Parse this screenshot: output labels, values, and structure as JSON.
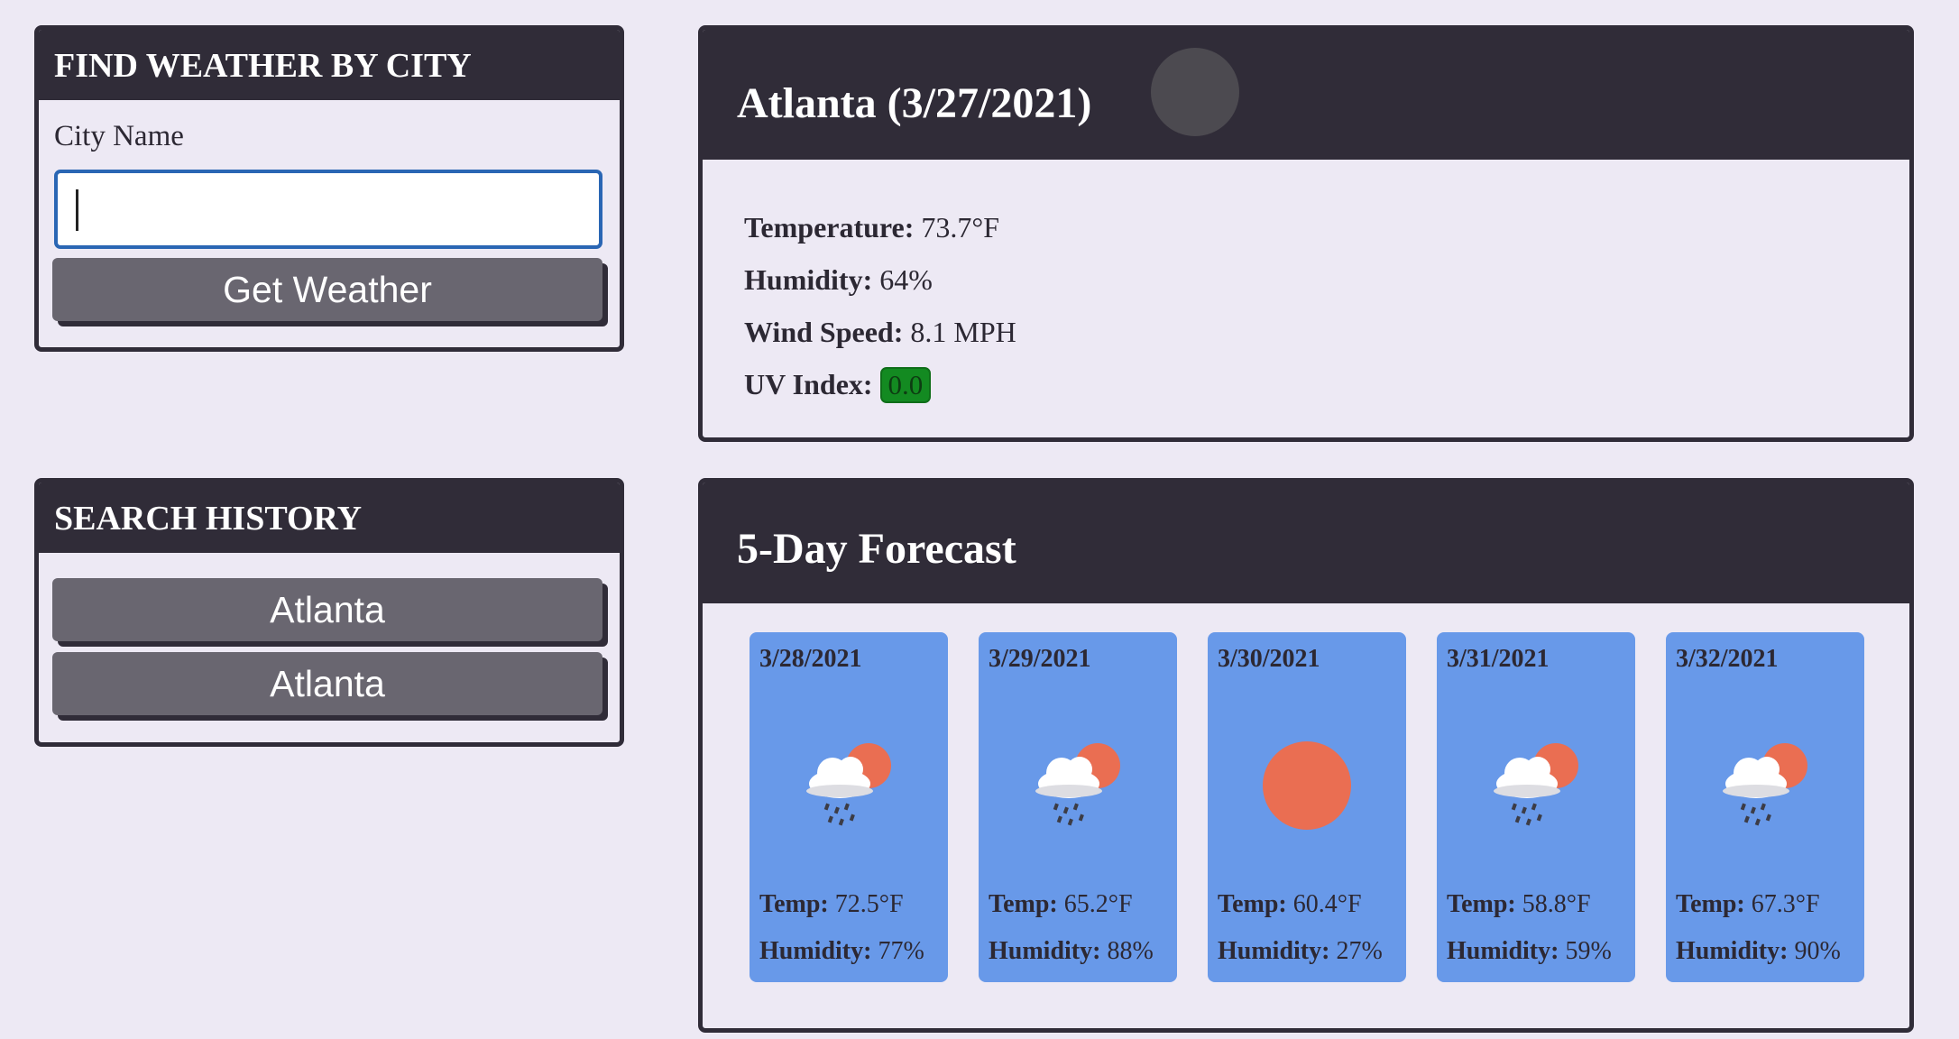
{
  "search": {
    "title": "FIND WEATHER BY CITY",
    "city_label": "City Name",
    "city_value": "",
    "button_label": "Get Weather"
  },
  "history": {
    "title": "SEARCH HISTORY",
    "items": [
      "Atlanta",
      "Atlanta"
    ]
  },
  "current": {
    "title": "Atlanta (3/27/2021)",
    "icon": "weather-icon",
    "temperature_label": "Temperature:",
    "temperature_value": "73.7°F",
    "humidity_label": "Humidity:",
    "humidity_value": "64%",
    "wind_label": "Wind Speed:",
    "wind_value": "8.1 MPH",
    "uv_label": "UV Index:",
    "uv_value": "0.0",
    "uv_color": "#138a21"
  },
  "forecast": {
    "title": "5-Day Forecast",
    "temp_label": "Temp:",
    "humidity_label": "Humidity:",
    "days": [
      {
        "date": "3/28/2021",
        "icon": "rain-sun-icon",
        "temp": "72.5°F",
        "humidity": "77%"
      },
      {
        "date": "3/29/2021",
        "icon": "rain-sun-icon",
        "temp": "65.2°F",
        "humidity": "88%"
      },
      {
        "date": "3/30/2021",
        "icon": "sun-icon",
        "temp": "60.4°F",
        "humidity": "27%"
      },
      {
        "date": "3/31/2021",
        "icon": "rain-sun-icon",
        "temp": "58.8°F",
        "humidity": "59%"
      },
      {
        "date": "3/32/2021",
        "icon": "rain-sun-icon",
        "temp": "67.3°F",
        "humidity": "90%"
      }
    ]
  },
  "colors": {
    "background": "#ede9f4",
    "header": "#302c38",
    "button": "#696670",
    "card": "#6899e9",
    "sun": "#ea6e52",
    "input_border": "#2a66b4"
  }
}
